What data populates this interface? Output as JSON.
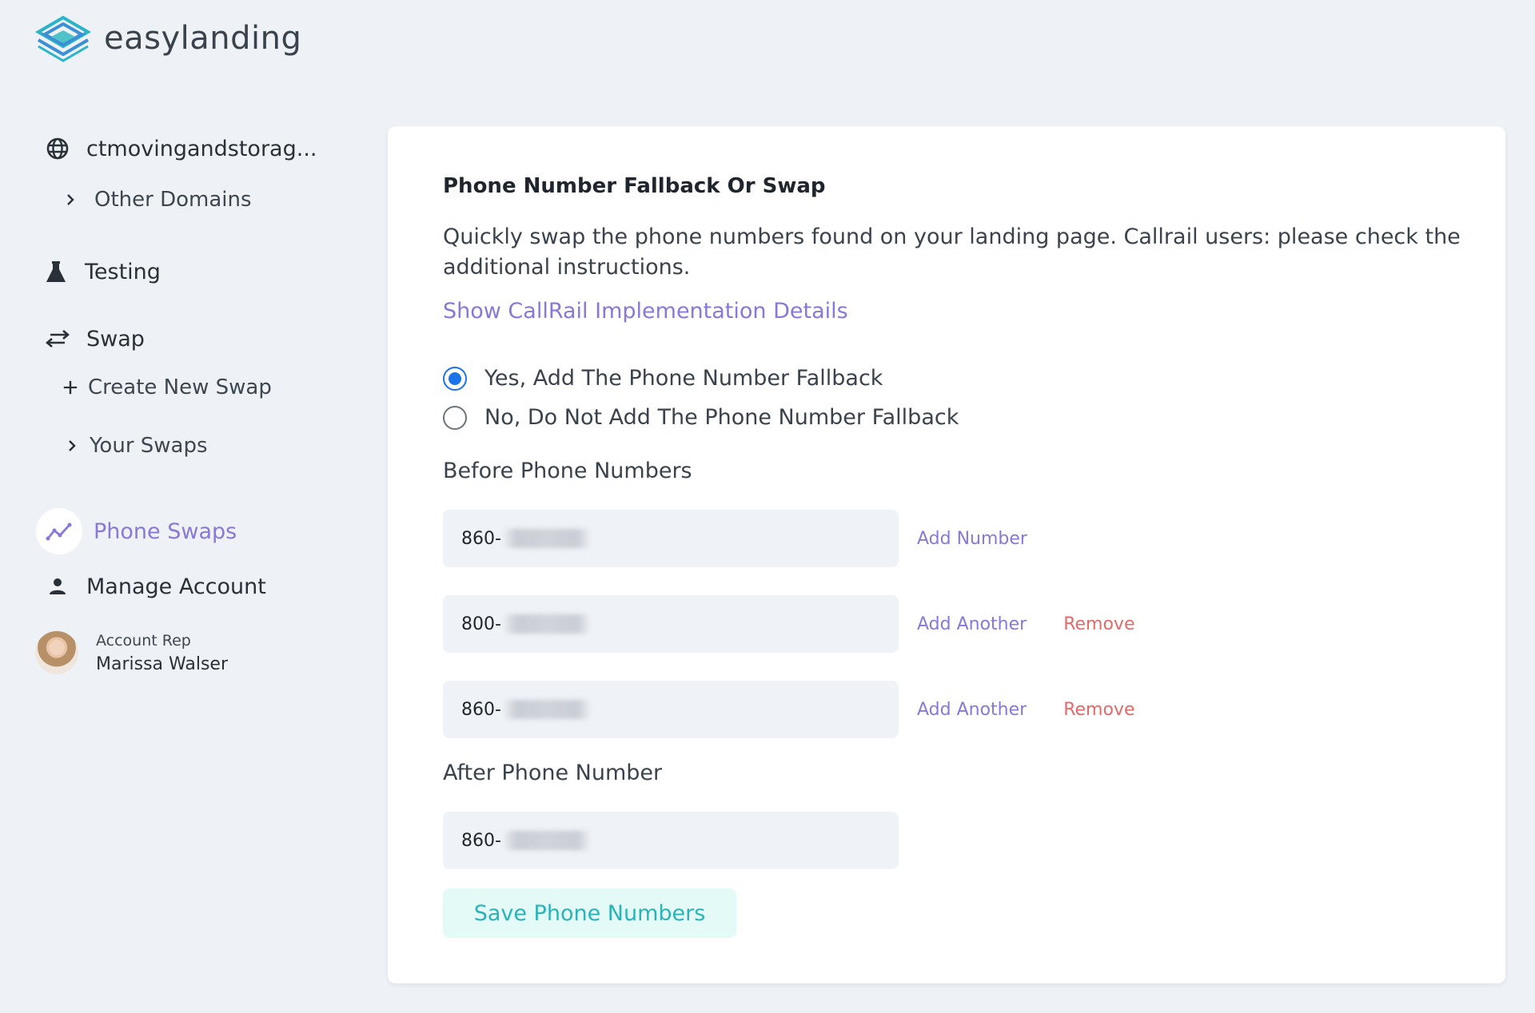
{
  "brand": {
    "name": "easylanding"
  },
  "sidebar": {
    "domain": "ctmovingandstorag...",
    "other_domains": "Other Domains",
    "testing": "Testing",
    "swap": "Swap",
    "create_new_swap": "Create New Swap",
    "your_swaps": "Your Swaps",
    "phone_swaps": "Phone Swaps",
    "manage_account": "Manage Account",
    "account_rep": {
      "role": "Account Rep",
      "name": "Marissa Walser"
    }
  },
  "main": {
    "title": "Phone Number Fallback Or Swap",
    "description": "Quickly swap the phone numbers found on your landing page. Callrail users: please check the additional instructions.",
    "show_link": "Show CallRail Implementation Details",
    "options": [
      {
        "label": "Yes, Add The Phone Number Fallback",
        "checked": true
      },
      {
        "label": "No, Do Not Add The Phone Number Fallback",
        "checked": false
      }
    ],
    "before_label": "Before Phone Numbers",
    "before_numbers": [
      {
        "prefix": "860-",
        "add_label": "Add Number",
        "remove_label": ""
      },
      {
        "prefix": "800-",
        "add_label": "Add Another",
        "remove_label": "Remove"
      },
      {
        "prefix": "860-",
        "add_label": "Add Another",
        "remove_label": "Remove"
      }
    ],
    "after_label": "After Phone Number",
    "after_number": {
      "prefix": "860-"
    },
    "save_button": "Save Phone Numbers"
  },
  "colors": {
    "accent": "#8a78d8",
    "remove": "#e26a6a",
    "save_bg": "#e4faf7",
    "save_text": "#2bb3b8",
    "radio": "#1a73e8",
    "background": "#eef2f6"
  }
}
